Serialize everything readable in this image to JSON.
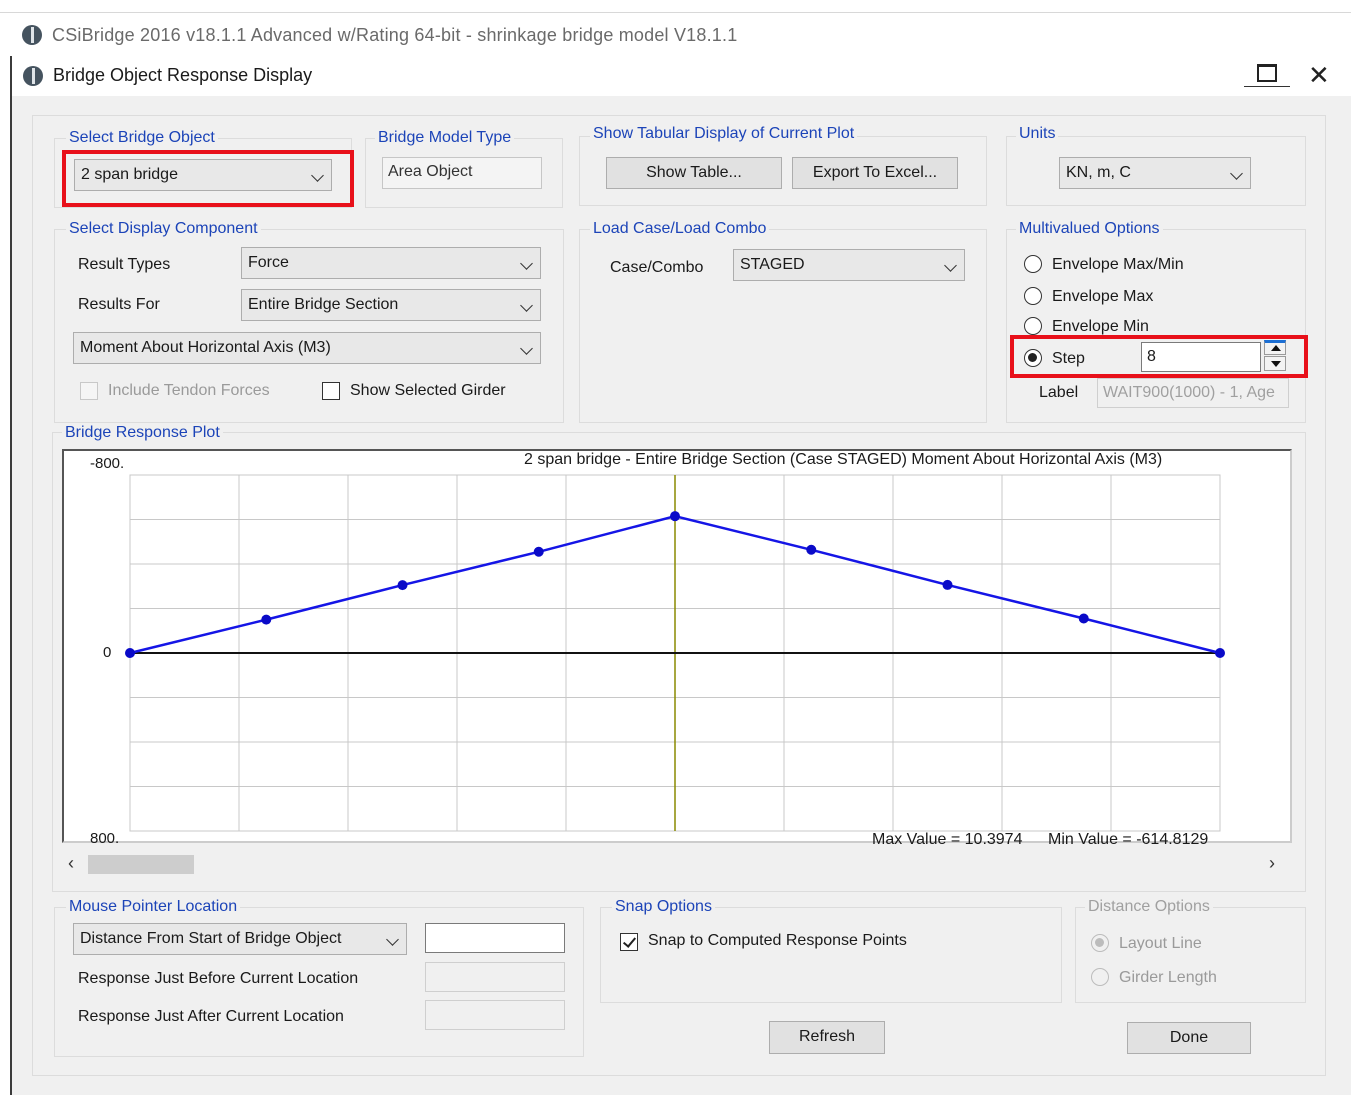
{
  "app": {
    "title": "CSiBridge 2016 v18.1.1 Advanced w/Rating 64-bit - shrinkage bridge model V18.1.1",
    "icon": "csi-logo-icon"
  },
  "dialog": {
    "title": "Bridge Object Response Display",
    "restore_icon": "restore-window-icon",
    "close_label": "✕"
  },
  "select_object": {
    "group_label": "Select Bridge Object",
    "value": "2 span bridge"
  },
  "model_type": {
    "group_label": "Bridge Model Type",
    "value": "Area Object"
  },
  "tabular": {
    "group_label": "Show Tabular Display of Current Plot",
    "show_table_label": "Show Table...",
    "export_label": "Export To Excel..."
  },
  "units": {
    "group_label": "Units",
    "value": "KN, m, C"
  },
  "display_component": {
    "group_label": "Select Display Component",
    "result_types_label": "Result Types",
    "result_types_value": "Force",
    "results_for_label": "Results For",
    "results_for_value": "Entire Bridge Section",
    "component_value": "Moment About Horizontal Axis  (M3)",
    "include_tendon_label": "Include Tendon Forces",
    "show_girder_label": "Show Selected Girder"
  },
  "load_case": {
    "group_label": "Load Case/Load Combo",
    "case_label": "Case/Combo",
    "case_value": "STAGED"
  },
  "multivalued": {
    "group_label": "Multivalued Options",
    "options": [
      "Envelope Max/Min",
      "Envelope Max",
      "Envelope Min",
      "Step"
    ],
    "selected": "Step",
    "step_value": "8",
    "label_label": "Label",
    "label_value": "WAIT900(1000) - 1, Age"
  },
  "plot": {
    "group_label": "Bridge Response Plot",
    "header": "2 span bridge - Entire Bridge Section   (Case STAGED)   Moment About Horizontal Axis  (M3)",
    "y_top_label": "-800.",
    "y_zero_label": "0",
    "y_bottom_label": "800.",
    "max_text": "Max Value = 10.3974",
    "min_text": "Min Value = -614.8129",
    "scroll_left": "‹",
    "scroll_right": "›",
    "colors": {
      "line": "#1515e6",
      "point": "#0a0ac8",
      "axis": "#111111",
      "grid": "#c8c8c8",
      "center": "#8a8a00"
    }
  },
  "chart_data": {
    "type": "line",
    "title": "2 span bridge - Entire Bridge Section   (Case STAGED)   Moment About Horizontal Axis  (M3)",
    "xlabel": "",
    "ylabel": "",
    "ylim": [
      800,
      -800
    ],
    "x": [
      0,
      1,
      2,
      3,
      4,
      5,
      6,
      7,
      8
    ],
    "values": [
      0,
      -150,
      -305,
      -455,
      -615,
      -464,
      -306,
      -155,
      0
    ],
    "grid": true,
    "x_gridlines": 10,
    "y_gridlines": 8
  },
  "mouse_location": {
    "group_label": "Mouse Pointer Location",
    "distance_value": "Distance From Start of Bridge Object",
    "before_label": "Response Just Before Current Location",
    "after_label": "Response Just After Current Location"
  },
  "snap": {
    "group_label": "Snap Options",
    "checkbox_label": "Snap to Computed Response Points"
  },
  "distance_options": {
    "group_label": "Distance Options",
    "layout_label": "Layout Line",
    "girder_label": "Girder Length"
  },
  "buttons": {
    "refresh_label": "Refresh",
    "done_label": "Done"
  }
}
